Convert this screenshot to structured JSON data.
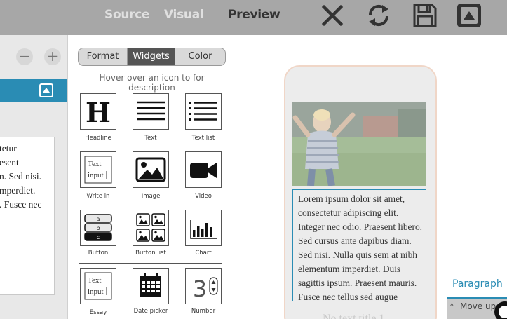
{
  "topbar": {
    "tabs": [
      {
        "label": "Source",
        "active": false
      },
      {
        "label": "Visual",
        "active": false
      },
      {
        "label": "Preview",
        "active": true
      }
    ],
    "icons": [
      "close-icon",
      "refresh-icon",
      "save-icon",
      "collapse-up-icon"
    ]
  },
  "left_panel": {
    "minus_label": "−",
    "plus_label": "+",
    "text_lines": [
      "tetur",
      "esent",
      "n. Sed nisi.",
      "mperdiet.",
      ". Fusce nec"
    ]
  },
  "widget_panel": {
    "segments": [
      "Format",
      "Widgets",
      "Color"
    ],
    "active_segment": "Widgets",
    "hint": "Hover over an icon to for description",
    "widgets": [
      {
        "label": "Headline",
        "icon": "headline-icon"
      },
      {
        "label": "Text",
        "icon": "text-icon"
      },
      {
        "label": "Text list",
        "icon": "text-list-icon"
      },
      {
        "label": "Write in",
        "icon": "write-in-icon",
        "sample": [
          "Text",
          "input"
        ]
      },
      {
        "label": "Image",
        "icon": "image-icon"
      },
      {
        "label": "Video",
        "icon": "video-icon"
      },
      {
        "label": "Button",
        "icon": "button-icon",
        "sample": [
          "a",
          "b",
          "c"
        ]
      },
      {
        "label": "Button list",
        "icon": "button-list-icon"
      },
      {
        "label": "Chart",
        "icon": "chart-icon"
      },
      {
        "label": "Essay",
        "icon": "essay-icon",
        "sample": [
          "Text",
          "input"
        ]
      },
      {
        "label": "Date picker",
        "icon": "date-picker-icon"
      },
      {
        "label": "Number",
        "icon": "number-icon",
        "sample": [
          "3"
        ]
      }
    ]
  },
  "preview": {
    "paragraph_lines": [
      "Lorem ipsum dolor sit amet,",
      "consectetur adipiscing elit.",
      "Integer nec odio. Praesent libero.",
      "Sed cursus ante dapibus diam.",
      "Sed nisi. Nulla quis sem at nibh",
      "elementum imperdiet. Duis",
      "sagittis ipsum. Praesent mauris.",
      "Fusce nec tellus sed augue"
    ],
    "faded_heading": "No text title 1"
  },
  "right_panel": {
    "tab": "Paragraph",
    "move_up": "Move up"
  },
  "colors": {
    "accent": "#2a8cb4",
    "topbar": "#a7a7a7",
    "phone_border": "#f0d6c7"
  }
}
